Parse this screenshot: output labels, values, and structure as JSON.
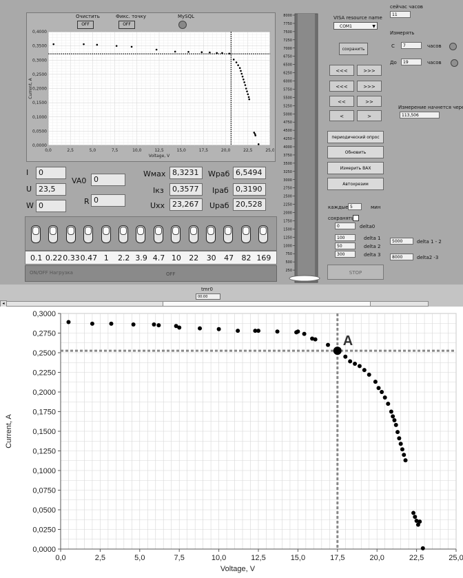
{
  "top": {
    "clear_label": "Очистить",
    "clear_value": "OFF",
    "fix_label": "Фикс. точку",
    "fix_value": "OFF",
    "mysql_label": "MySQL"
  },
  "small_plot": {
    "xlabel": "Voltage, V",
    "ylabel": "Current, A",
    "xticks": [
      "0,0",
      "2,5",
      "5,0",
      "7,5",
      "10,0",
      "12,5",
      "15,0",
      "17,5",
      "20,0",
      "22,5",
      "25,0"
    ],
    "yticks": [
      "0,0000",
      "0,0500",
      "0,1000",
      "0,1500",
      "0,2000",
      "0,2500",
      "0,3000",
      "0,3500",
      "0,4000"
    ]
  },
  "scale": {
    "ticks": [
      "8000",
      "7750",
      "7500",
      "7250",
      "7000",
      "6750",
      "6500",
      "6250",
      "6000",
      "5750",
      "5500",
      "5250",
      "5000",
      "4750",
      "4500",
      "4250",
      "4000",
      "3750",
      "3500",
      "3250",
      "3000",
      "2750",
      "2500",
      "2250",
      "2000",
      "1750",
      "1500",
      "1250",
      "1000",
      "750",
      "500",
      "250",
      "0"
    ]
  },
  "readouts": {
    "I_label": "I",
    "I_value": "0",
    "U_label": "U",
    "U_value": "23,5",
    "W_label": "W",
    "W_value": "0",
    "VA0_label": "VA0",
    "VA0_value": "0",
    "R_label": "R",
    "R_value": "0",
    "Wmax_label": "Wмах",
    "Wmax_value": "8,3231",
    "Wrab_label": "Wраб",
    "Wrab_value": "6,5494",
    "Ikz_label": "Iкз",
    "Ikz_value": "0,3577",
    "Irab_label": "Iраб",
    "Irab_value": "0,3190",
    "Uxx_label": "Uхх",
    "Uxx_value": "23,267",
    "Urab_label": "Uраб",
    "Urab_value": "20,528"
  },
  "resistors": [
    "0.1",
    "0.22",
    "0.33",
    "0.47",
    "1",
    "2.2",
    "3.9",
    "4.7",
    "10",
    "22",
    "30",
    "47",
    "82",
    "169"
  ],
  "onoff": {
    "label": "ON/OFF Нагрузка",
    "value": "OFF"
  },
  "visa": {
    "label": "VISA resource name",
    "value": "COM1",
    "save": "сохранить"
  },
  "nav": {
    "b1l": "<<<",
    "b1r": ">>>",
    "b2l": "<<<",
    "b2r": ">>>",
    "b3l": "<<",
    "b3r": ">>",
    "b4l": "<",
    "b4r": ">"
  },
  "actions": {
    "periodic": "периодический опрос",
    "refresh": "Обновить",
    "measure": "Измерить ВАХ",
    "auto": "Автохрезим",
    "stop": "STOP"
  },
  "every": {
    "label": "каждые",
    "value": "5",
    "unit": "мин"
  },
  "save_ctrl": {
    "label": "сохранять",
    "delta0_value": "0",
    "delta0_label": "delta0"
  },
  "deltas": [
    {
      "value": "100",
      "label": "delta 1"
    },
    {
      "value": "50",
      "label": "delta 2"
    },
    {
      "value": "300",
      "label": "delta 3"
    }
  ],
  "delta12": {
    "value": "5000",
    "label": "delta 1 - 2"
  },
  "delta23": {
    "value": "8000",
    "label": "delta2 -3"
  },
  "right": {
    "hours_now_label": "сейчас часов",
    "hours_now_value": "11",
    "measure_label": "Измерять",
    "from_label": "С",
    "from_value": "7",
    "from_unit": "часов",
    "to_label": "До",
    "to_value": "19",
    "to_unit": "часов",
    "starts_label": "Измерение начнется через",
    "starts_value": "113,506"
  },
  "bottom": {
    "tmr_label": "tmr0",
    "tmr_value": "00:00"
  },
  "chart_data": {
    "type": "scatter",
    "title": "",
    "xlabel": "Voltage, V",
    "ylabel": "Current, A",
    "xlim": [
      0,
      25
    ],
    "ylim": [
      0,
      0.3
    ],
    "xticks": [
      "0,0",
      "2,5",
      "5,0",
      "7,5",
      "10,0",
      "12,5",
      "15,0",
      "17,5",
      "20,0",
      "22,5",
      "25,0"
    ],
    "yticks": [
      "0,0000",
      "0,0250",
      "0,0500",
      "0,0750",
      "0,1000",
      "0,1250",
      "0,1500",
      "0,1750",
      "0,2000",
      "0,2250",
      "0,2500",
      "0,2750",
      "0,3000"
    ],
    "grid": true,
    "annotation": {
      "text": "A",
      "x": 17.5,
      "y": 0.2525
    },
    "cursor": {
      "x": 17.5,
      "y": 0.2525
    },
    "points": [
      [
        0.5,
        0.289
      ],
      [
        2.0,
        0.287
      ],
      [
        3.2,
        0.287
      ],
      [
        4.6,
        0.286
      ],
      [
        5.9,
        0.286
      ],
      [
        6.2,
        0.285
      ],
      [
        7.3,
        0.284
      ],
      [
        7.5,
        0.282
      ],
      [
        8.8,
        0.281
      ],
      [
        10.0,
        0.28
      ],
      [
        11.2,
        0.278
      ],
      [
        12.3,
        0.278
      ],
      [
        12.5,
        0.278
      ],
      [
        13.7,
        0.277
      ],
      [
        14.9,
        0.276
      ],
      [
        15.0,
        0.277
      ],
      [
        15.4,
        0.274
      ],
      [
        15.9,
        0.268
      ],
      [
        16.1,
        0.267
      ],
      [
        16.9,
        0.26
      ],
      [
        17.5,
        0.252
      ],
      [
        17.6,
        0.254
      ],
      [
        18.0,
        0.245
      ],
      [
        18.3,
        0.239
      ],
      [
        18.6,
        0.236
      ],
      [
        18.9,
        0.233
      ],
      [
        19.2,
        0.228
      ],
      [
        19.5,
        0.222
      ],
      [
        19.9,
        0.213
      ],
      [
        20.1,
        0.205
      ],
      [
        20.3,
        0.2
      ],
      [
        20.5,
        0.193
      ],
      [
        20.7,
        0.185
      ],
      [
        20.9,
        0.175
      ],
      [
        21.0,
        0.169
      ],
      [
        21.1,
        0.164
      ],
      [
        21.2,
        0.158
      ],
      [
        21.3,
        0.149
      ],
      [
        21.4,
        0.141
      ],
      [
        21.5,
        0.134
      ],
      [
        21.6,
        0.127
      ],
      [
        21.7,
        0.12
      ],
      [
        21.8,
        0.113
      ],
      [
        22.3,
        0.046
      ],
      [
        22.4,
        0.041
      ],
      [
        22.5,
        0.036
      ],
      [
        22.7,
        0.035
      ],
      [
        22.6,
        0.031
      ],
      [
        22.9,
        0.001
      ]
    ]
  }
}
